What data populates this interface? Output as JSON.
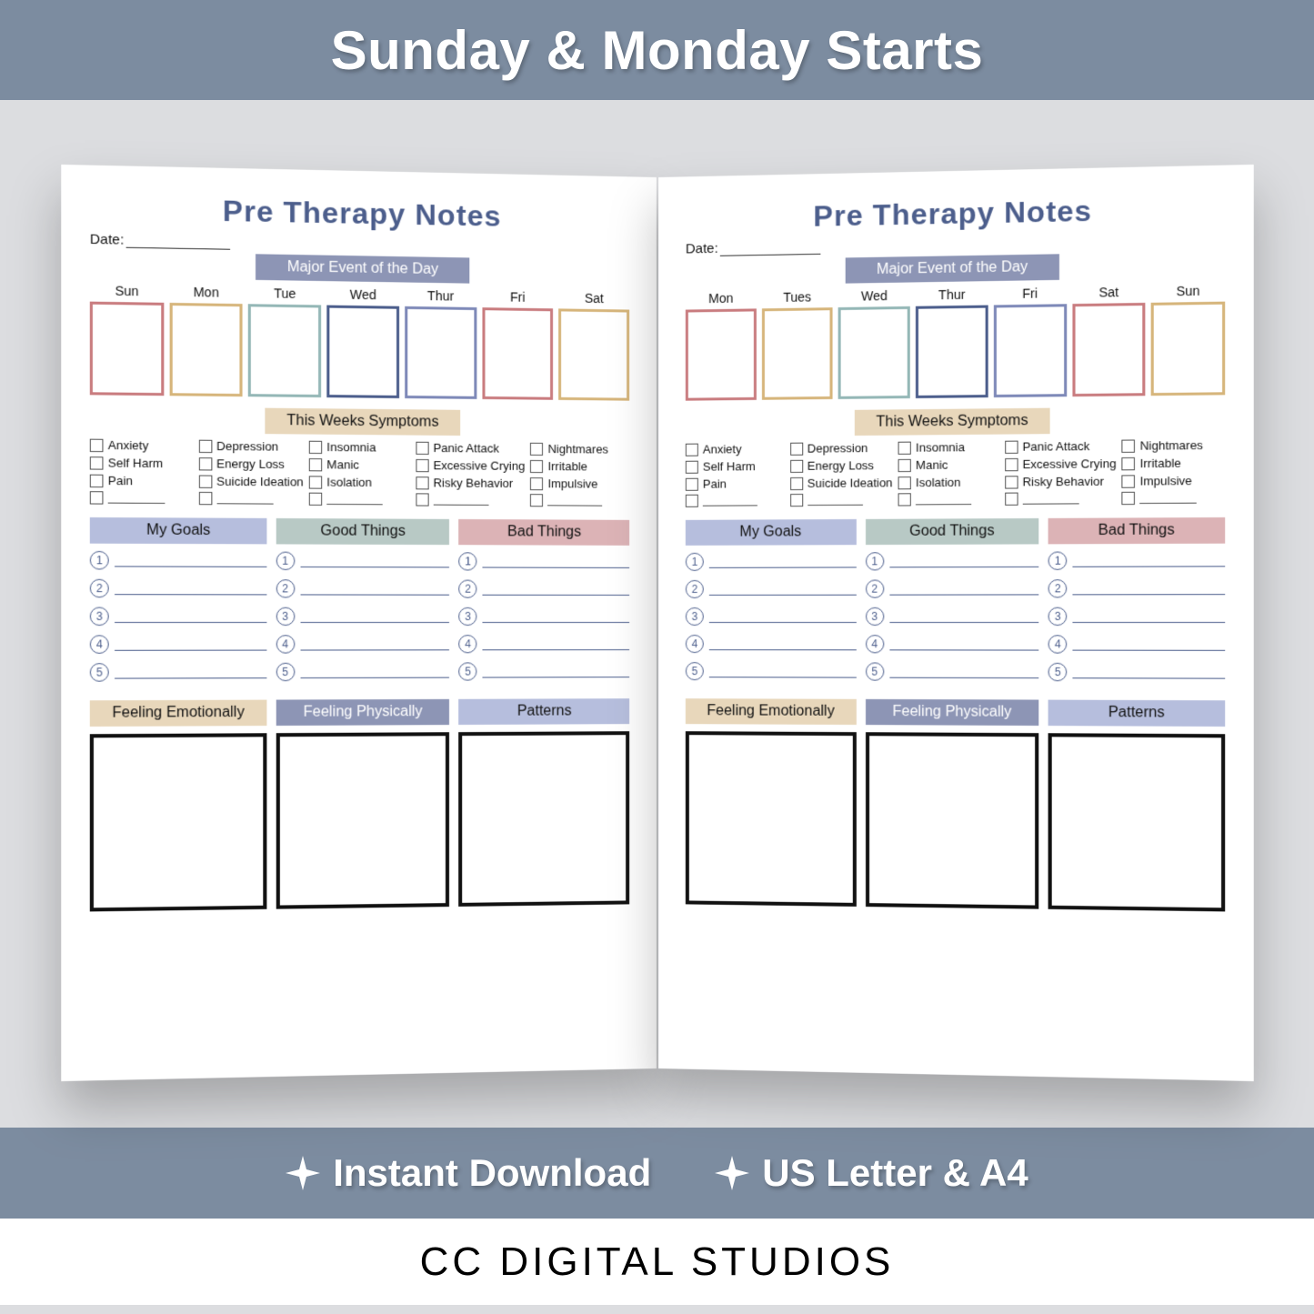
{
  "banner_title": "Sunday & Monday Starts",
  "features": [
    "Instant Download",
    "US Letter & A4"
  ],
  "brand": "CC DIGITAL STUDIOS",
  "page_title": "Pre Therapy Notes",
  "date_label": "Date:",
  "section_major": "Major Event of the Day",
  "section_symptoms": "This Weeks Symptoms",
  "section_goals": "My Goals",
  "section_good": "Good Things",
  "section_bad": "Bad Things",
  "section_emot": "Feeling Emotionally",
  "section_phys": "Feeling Physically",
  "section_pat": "Patterns",
  "days_sun_start": [
    "Sun",
    "Mon",
    "Tue",
    "Wed",
    "Thur",
    "Fri",
    "Sat"
  ],
  "days_mon_start": [
    "Mon",
    "Tues",
    "Wed",
    "Thur",
    "Fri",
    "Sat",
    "Sun"
  ],
  "symptoms": [
    [
      "Anxiety",
      "Depression",
      "Insomnia",
      "Panic Attack",
      "Nightmares"
    ],
    [
      "Self Harm",
      "Energy Loss",
      "Manic",
      "Excessive Crying",
      "Irritable"
    ],
    [
      "Pain",
      "Suicide Ideation",
      "Isolation",
      "Risky Behavior",
      "Impulsive"
    ]
  ],
  "numbers": [
    "1",
    "2",
    "3",
    "4",
    "5"
  ],
  "day_box_colors": [
    "c-rose",
    "c-tan",
    "c-teal",
    "c-navy",
    "c-purple",
    "c-rose",
    "c-tan"
  ]
}
